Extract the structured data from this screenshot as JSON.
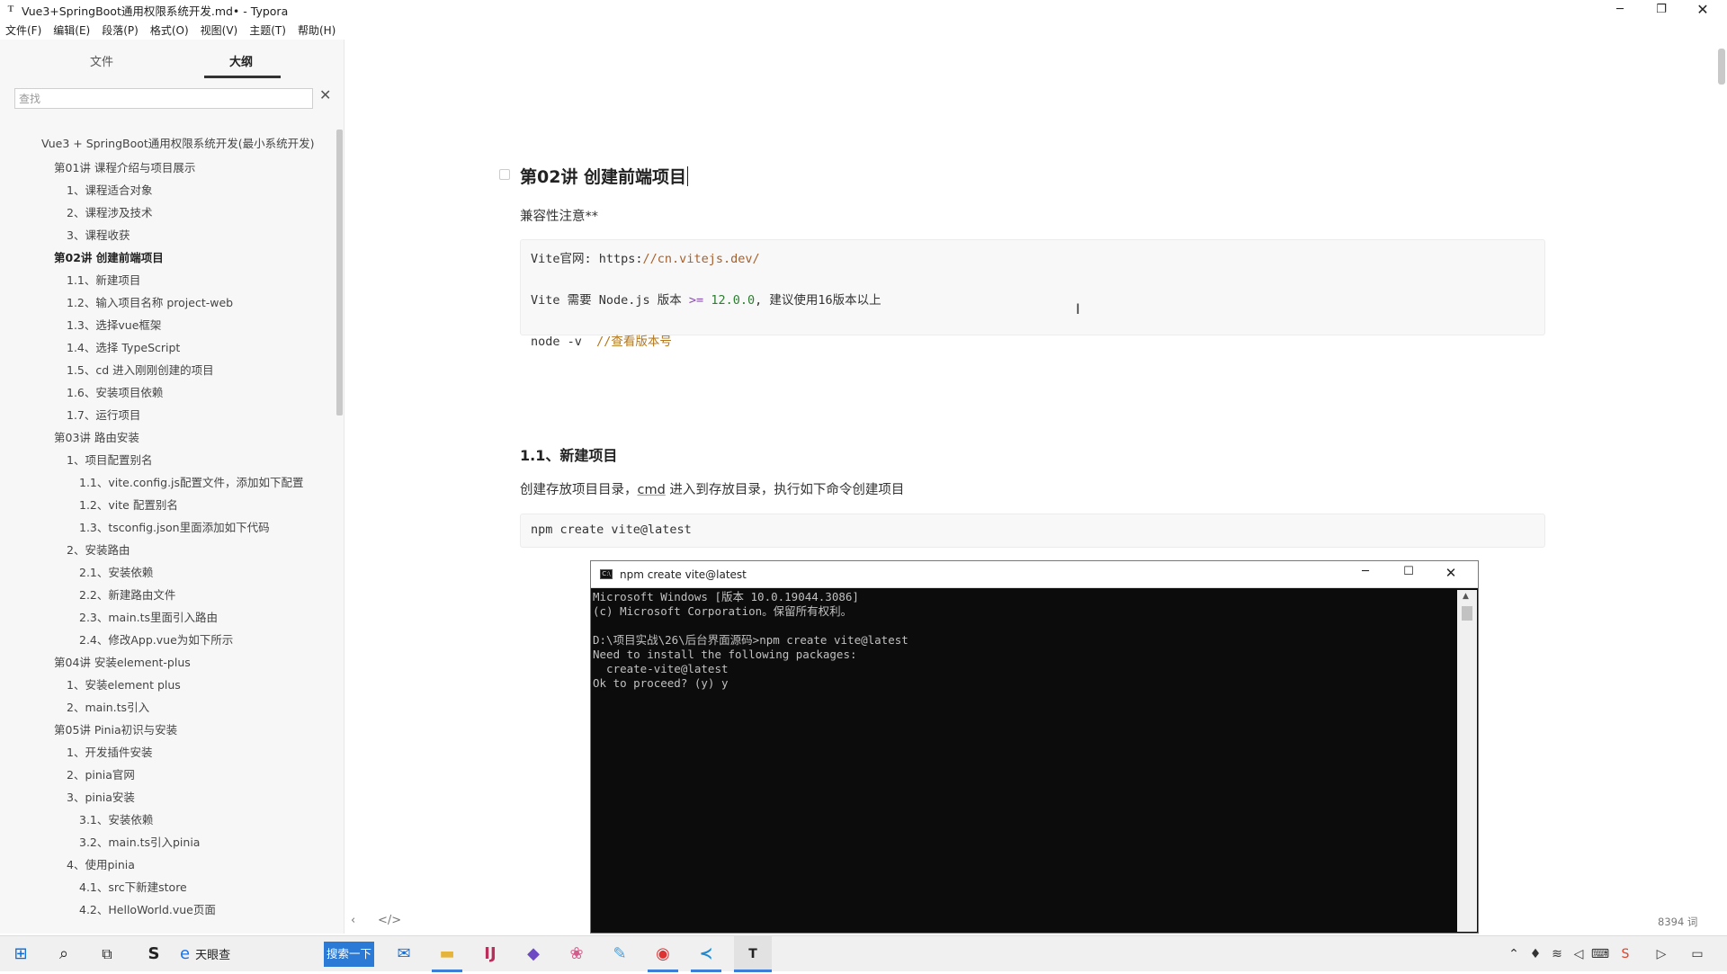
{
  "window": {
    "title": "Vue3+SpringBoot通用权限系统开发.md• - Typora",
    "app_icon": "T",
    "min": "─",
    "max": "❐",
    "close": "✕"
  },
  "menu": [
    "文件(F)",
    "编辑(E)",
    "段落(P)",
    "格式(O)",
    "视图(V)",
    "主题(T)",
    "帮助(H)"
  ],
  "sidebar": {
    "tab_files": "文件",
    "tab_outline": "大纲",
    "search_placeholder": "查找",
    "clear": "✕",
    "outline": [
      {
        "text": "Vue3 + SpringBoot通用权限系统开发(最小系统开发)",
        "level": 1
      },
      {
        "text": "第01讲 课程介绍与项目展示",
        "level": 2
      },
      {
        "text": "1、课程适合对象",
        "level": 3
      },
      {
        "text": "2、课程涉及技术",
        "level": 3
      },
      {
        "text": "3、课程收获",
        "level": 3
      },
      {
        "text": "第02讲 创建前端项目",
        "level": 2,
        "active": true
      },
      {
        "text": "1.1、新建项目",
        "level": 3
      },
      {
        "text": "1.2、输入项目名称 project-web",
        "level": 3
      },
      {
        "text": "1.3、选择vue框架",
        "level": 3
      },
      {
        "text": "1.4、选择 TypeScript",
        "level": 3
      },
      {
        "text": "1.5、cd 进入刚刚创建的项目",
        "level": 3
      },
      {
        "text": "1.6、安装项目依赖",
        "level": 3
      },
      {
        "text": "1.7、运行项目",
        "level": 3
      },
      {
        "text": "第03讲 路由安装",
        "level": 2
      },
      {
        "text": "1、项目配置别名",
        "level": 3
      },
      {
        "text": "1.1、vite.config.js配置文件，添加如下配置",
        "level": 4
      },
      {
        "text": "1.2、vite 配置别名",
        "level": 4
      },
      {
        "text": "1.3、tsconfig.json里面添加如下代码",
        "level": 4
      },
      {
        "text": "2、安装路由",
        "level": 3
      },
      {
        "text": "2.1、安装依赖",
        "level": 4
      },
      {
        "text": "2.2、新建路由文件",
        "level": 4
      },
      {
        "text": "2.3、main.ts里面引入路由",
        "level": 4
      },
      {
        "text": "2.4、修改App.vue为如下所示",
        "level": 4
      },
      {
        "text": "第04讲 安装element-plus",
        "level": 2
      },
      {
        "text": "1、安装element plus",
        "level": 3
      },
      {
        "text": "2、main.ts引入",
        "level": 3
      },
      {
        "text": "第05讲 Pinia初识与安装",
        "level": 2
      },
      {
        "text": "1、开发插件安装",
        "level": 3
      },
      {
        "text": "2、pinia官网",
        "level": 3
      },
      {
        "text": "3、pinia安装",
        "level": 3
      },
      {
        "text": "3.1、安装依赖",
        "level": 4
      },
      {
        "text": "3.2、main.ts引入pinia",
        "level": 4
      },
      {
        "text": "4、使用pinia",
        "level": 3
      },
      {
        "text": "4.1、src下新建store",
        "level": 4
      },
      {
        "text": "4.2、HelloWorld.vue页面",
        "level": 4
      }
    ],
    "bottom_left": "‹",
    "bottom_code": "</>"
  },
  "editor": {
    "h2": "第02讲 创建前端项目",
    "note": "兼容性注意**",
    "code1": {
      "l1_a": "Vite官网: https:",
      "l1_b": "//cn.vitejs.dev/",
      "l2_a": "Vite 需要 Node.js 版本 ",
      "l2_op": ">=",
      "l2_num": " 12.0.0",
      "l2_b": ", 建议使用16版本以上",
      "l3_a": "node -v  ",
      "l3_cmt": "//查看版本号"
    },
    "h3": "1.1、新建项目",
    "para2_a": "创建存放项目目录，",
    "para2_link": "cmd",
    "para2_b": " 进入到存放目录，执行如下命令创建项目",
    "code2": "npm create vite@latest",
    "word_count": "8394 词"
  },
  "terminal": {
    "title": "npm create vite@latest",
    "lines": [
      "Microsoft Windows [版本 10.0.19044.3086]",
      "(c) Microsoft Corporation。保留所有权利。",
      "",
      "D:\\项目实战\\26\\后台界面源码>npm create vite@latest",
      "Need to install the following packages:",
      "  create-vite@latest",
      "Ok to proceed? (y) y"
    ]
  },
  "taskbar": {
    "ie_label": "天眼查",
    "search_btn": "搜索一下"
  }
}
